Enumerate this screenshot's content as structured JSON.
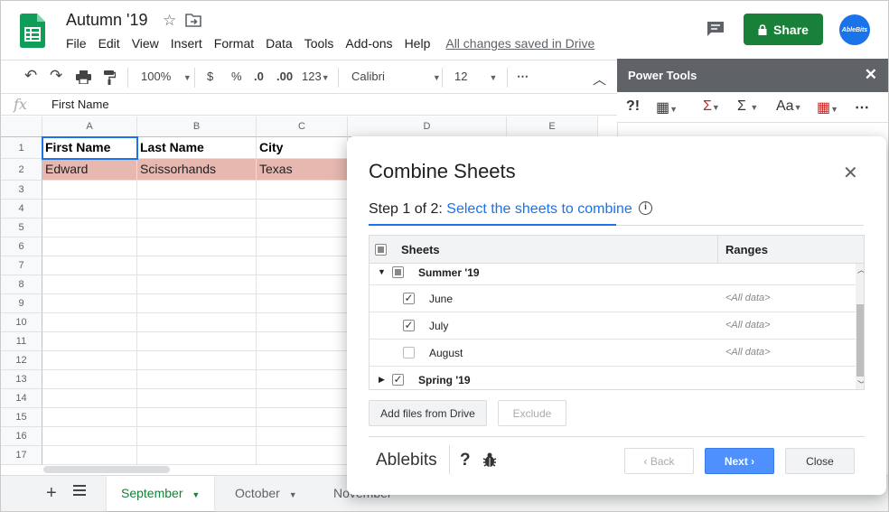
{
  "doc": {
    "title": "Autumn '19",
    "menu": [
      "File",
      "Edit",
      "View",
      "Insert",
      "Format",
      "Data",
      "Tools",
      "Add-ons",
      "Help"
    ],
    "saved_status": "All changes saved in Drive",
    "share_label": "Share",
    "avatar_text": "AbleBits"
  },
  "toolbar": {
    "zoom": "100%",
    "currency": "$",
    "percent": "%",
    "dec_decrease": ".0",
    "dec_increase": ".00",
    "number_format": "123",
    "font": "Calibri",
    "font_size": "12",
    "more": "⋯"
  },
  "formula": {
    "fx": "fx",
    "value": "First Name"
  },
  "grid": {
    "columns": [
      "A",
      "B",
      "C",
      "D",
      "E"
    ],
    "rows": [
      "1",
      "2",
      "3",
      "4",
      "5",
      "6",
      "7",
      "8",
      "9",
      "10",
      "11",
      "12",
      "13",
      "14",
      "15",
      "16",
      "17"
    ],
    "header_row": [
      "First Name",
      "Last Name",
      "City"
    ],
    "data_row": [
      "Edward",
      "Scissorhands",
      "Texas"
    ]
  },
  "sheet_tabs": {
    "tabs": [
      "September",
      "October",
      "November"
    ],
    "active": "September"
  },
  "power_tools": {
    "title": "Power Tools",
    "tools": [
      "?!",
      "▦",
      "Σ",
      "Σ",
      "Aa",
      "▦",
      "⋯"
    ]
  },
  "dialog": {
    "title": "Combine Sheets",
    "step_prefix": "Step 1 of 2:",
    "step_label": "Select the sheets to combine",
    "info": "i",
    "col_sheets": "Sheets",
    "col_ranges": "Ranges",
    "rows": [
      {
        "name": "Summer '19",
        "range": "",
        "checked": "partial"
      },
      {
        "name": "June",
        "range": "<All data>",
        "checked": true
      },
      {
        "name": "July",
        "range": "<All data>",
        "checked": true
      },
      {
        "name": "August",
        "range": "<All data>",
        "checked": false
      },
      {
        "name": "Spring '19",
        "range": "",
        "checked": true
      }
    ],
    "add_files": "Add files from Drive",
    "exclude": "Exclude",
    "brand": "Ablebits",
    "help": "?",
    "back": "‹ Back",
    "next": "Next ›",
    "close": "Close"
  }
}
